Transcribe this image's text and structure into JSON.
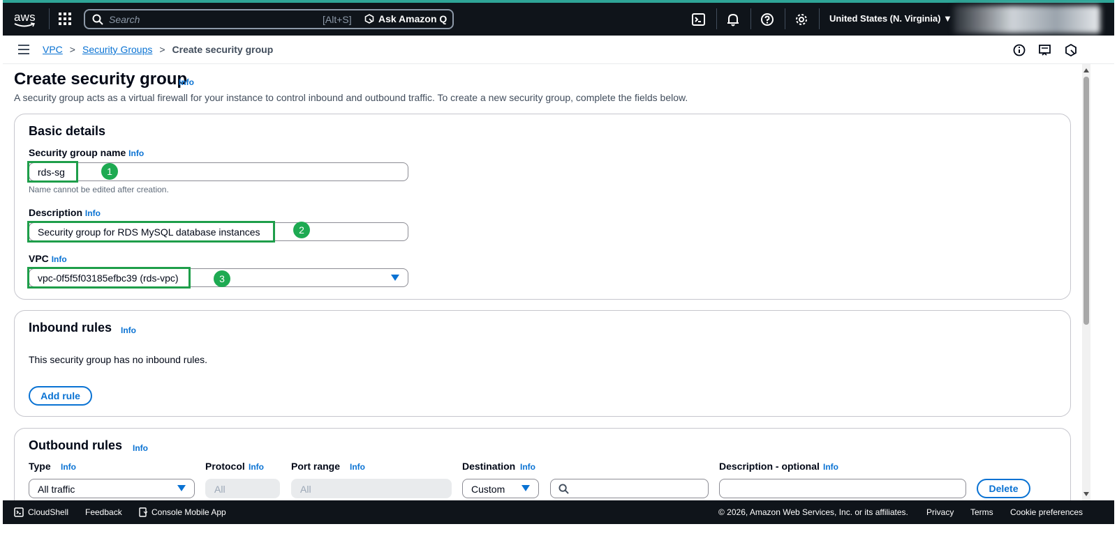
{
  "topnav": {
    "logo_text": "aws",
    "search_placeholder": "Search",
    "search_shortcut": "[Alt+S]",
    "ask_q_label": "Ask Amazon Q",
    "region": "United States (N. Virginia) ▼"
  },
  "breadcrumb": {
    "items": [
      "VPC",
      "Security Groups"
    ],
    "current": "Create security group"
  },
  "page": {
    "title": "Create security group",
    "title_info": "Info",
    "subtitle": "A security group acts as a virtual firewall for your instance to control inbound and outbound traffic. To create a new security group, complete the fields below."
  },
  "basic_details": {
    "heading": "Basic details",
    "name_label": "Security group name",
    "name_info": "Info",
    "name_value": "rds-sg",
    "name_hint": "Name cannot be edited after creation.",
    "desc_label": "Description",
    "desc_info": "Info",
    "desc_value": "Security group for RDS MySQL database instances",
    "vpc_label": "VPC",
    "vpc_info": "Info",
    "vpc_value": "vpc-0f5f5f03185efbc39 (rds-vpc)",
    "badges": [
      "1",
      "2",
      "3"
    ]
  },
  "inbound": {
    "heading": "Inbound rules",
    "info": "Info",
    "empty_text": "This security group has no inbound rules.",
    "add_rule": "Add rule"
  },
  "outbound": {
    "heading": "Outbound rules",
    "info": "Info",
    "columns": {
      "type": "Type",
      "protocol": "Protocol",
      "port_range": "Port range",
      "destination": "Destination",
      "description": "Description - optional"
    },
    "col_info": "Info",
    "row": {
      "type": "All traffic",
      "protocol": "All",
      "port_range": "All",
      "destination": "Custom",
      "description": ""
    },
    "delete": "Delete"
  },
  "footer": {
    "cloudshell": "CloudShell",
    "feedback": "Feedback",
    "mobile_app": "Console Mobile App",
    "copyright": "© 2026, Amazon Web Services, Inc. or its affiliates.",
    "privacy": "Privacy",
    "terms": "Terms",
    "cookie": "Cookie preferences"
  },
  "colors": {
    "nav_bg": "#0f141a",
    "link": "#0972d3",
    "highlight": "#1e9e4a",
    "accent_line": "#2ea597"
  }
}
